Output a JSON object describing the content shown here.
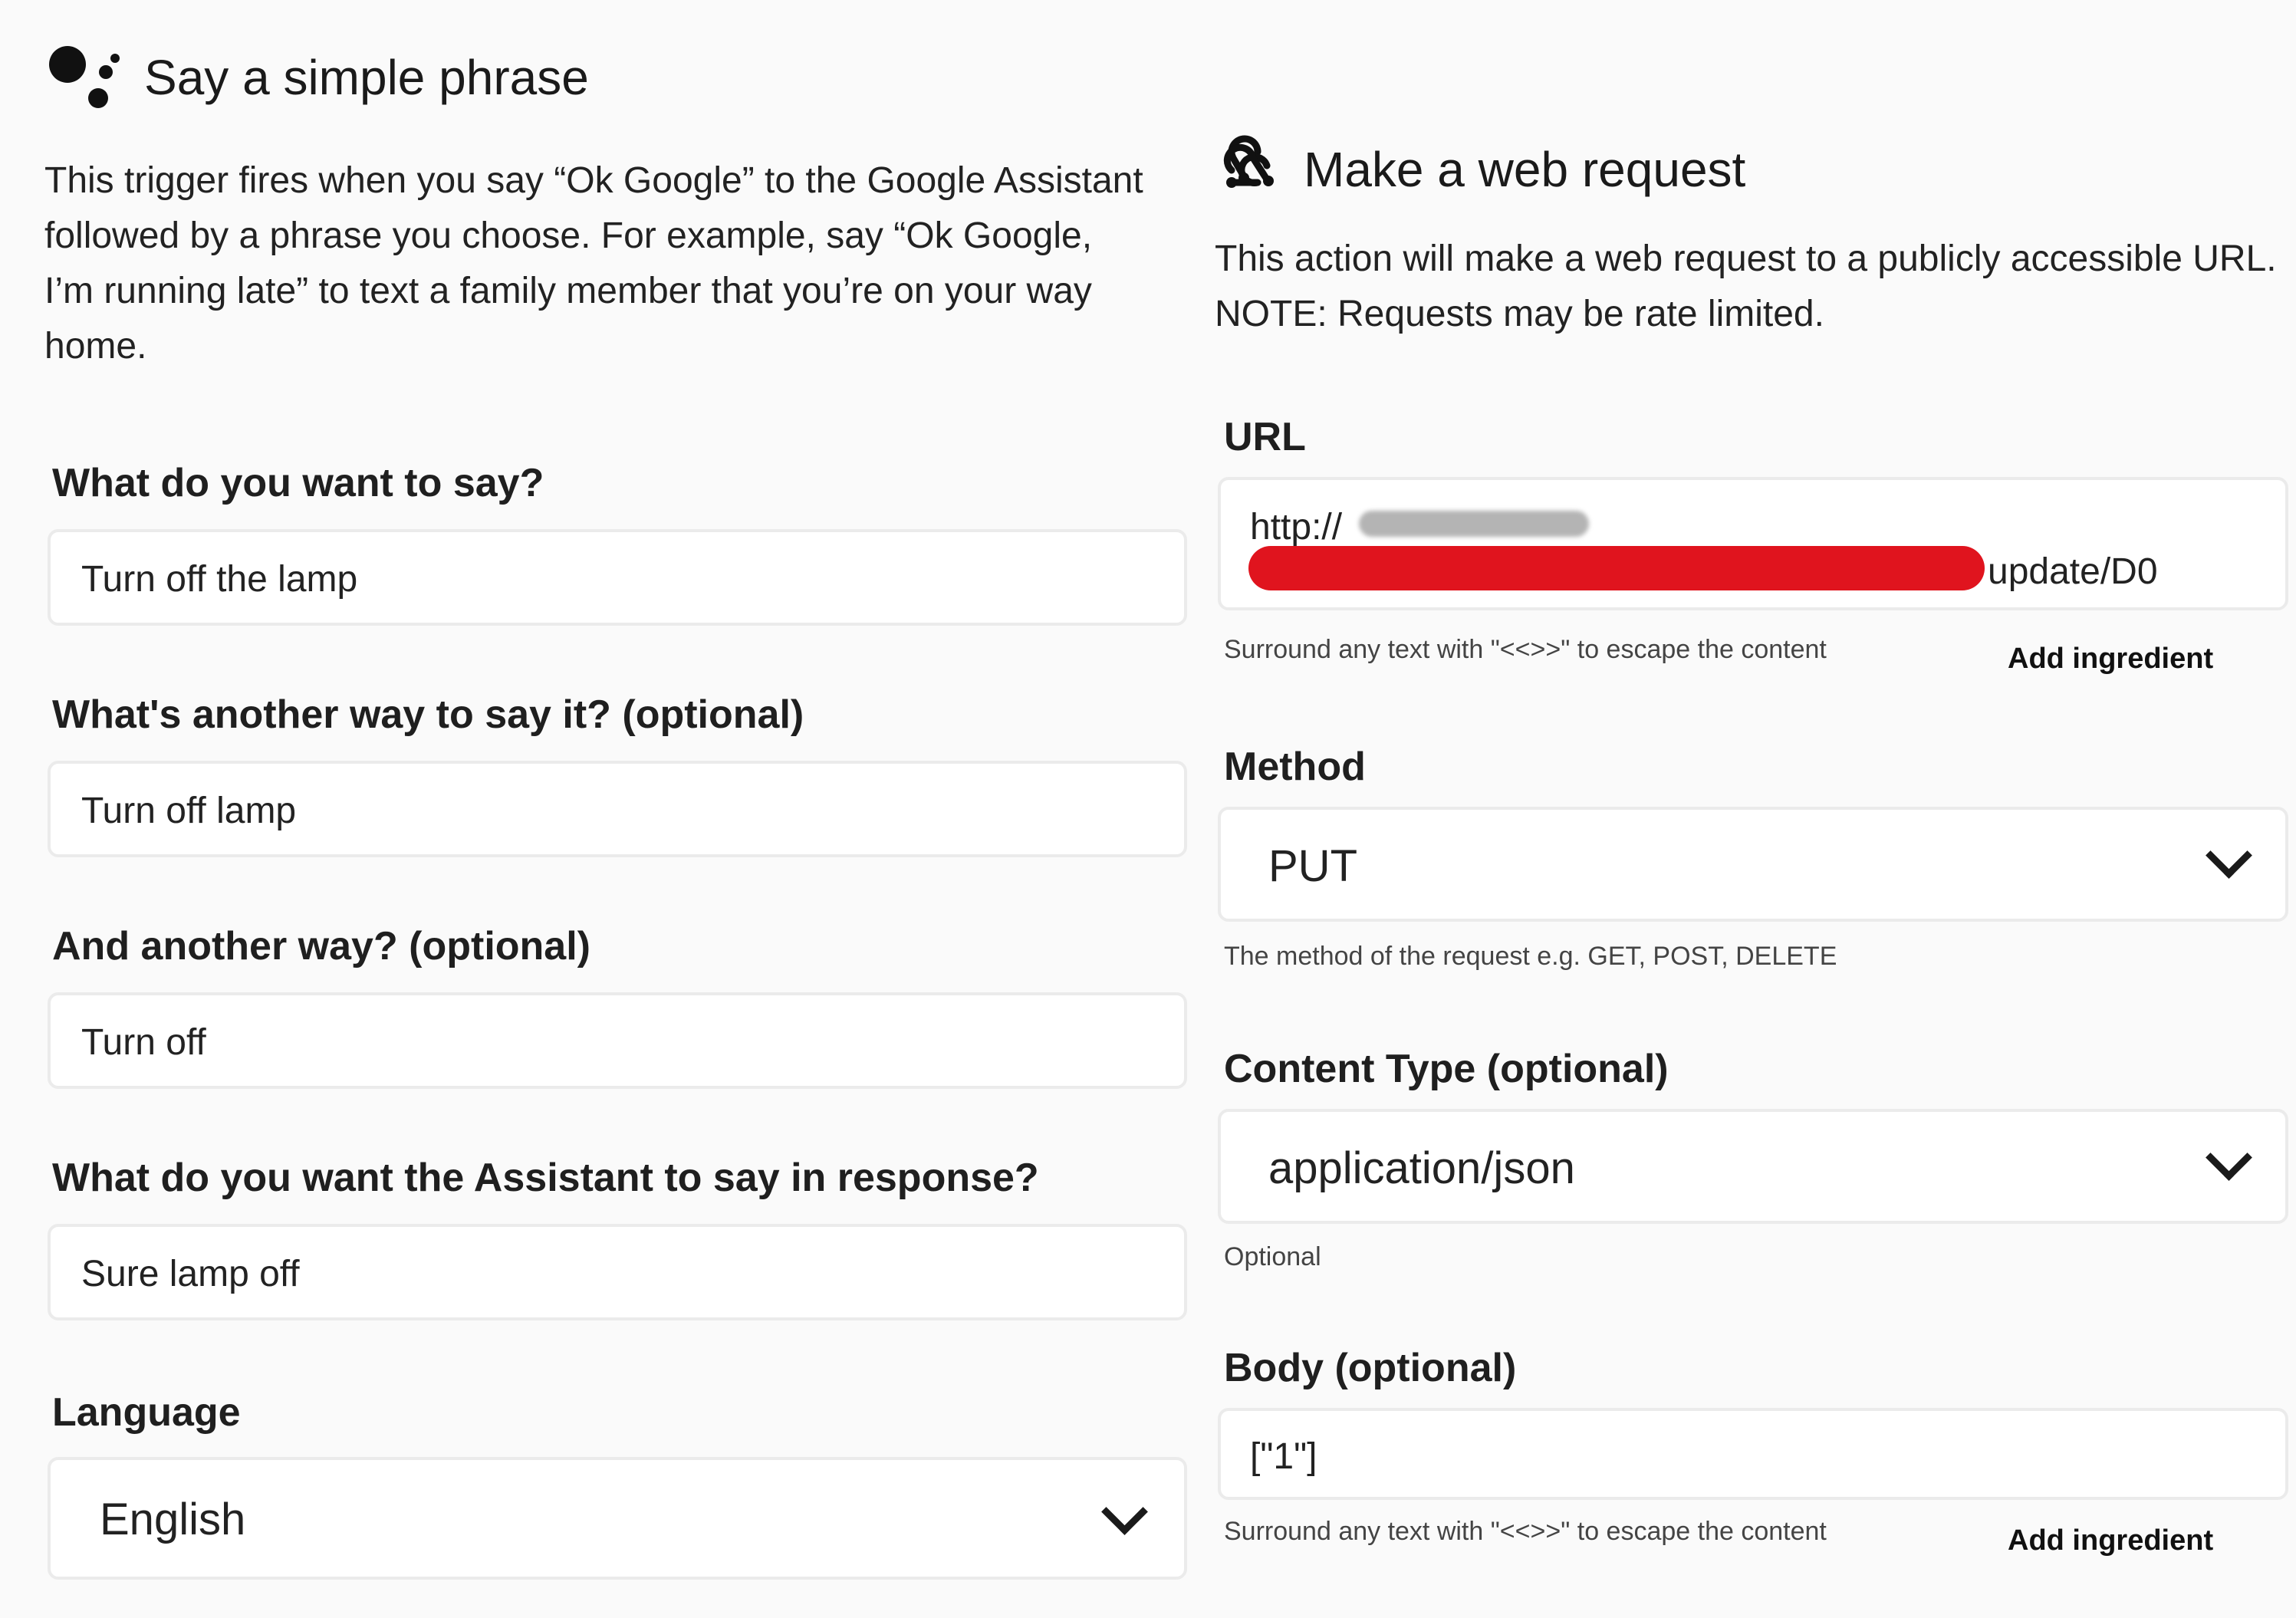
{
  "trigger": {
    "title": "Say a simple phrase",
    "icon": "google-assistant-icon",
    "description": "This trigger fires when you say “Ok Google” to the Google Assistant followed by a phrase you choose. For example, say “Ok Google, I’m running late” to text a family member that you’re on your way home.",
    "fields": {
      "phrase": {
        "label": "What do you want to say?",
        "value": "Turn off the lamp"
      },
      "alt_phrase": {
        "label": "What's another way to say it? (optional)",
        "value": "Turn off lamp"
      },
      "alt_phrase_2": {
        "label": "And another way? (optional)",
        "value": "Turn off"
      },
      "response": {
        "label": "What do you want the Assistant to say in response?",
        "value": "Sure lamp off"
      },
      "language": {
        "label": "Language",
        "value": "English"
      }
    }
  },
  "action": {
    "title": "Make a web request",
    "icon": "webhook-icon",
    "description": "This action will make a web request to a publicly accessible URL. NOTE: Requests may be rate limited.",
    "fields": {
      "url": {
        "label": "URL",
        "value_start": "http://",
        "value_end": "update/D0",
        "helper": "Surround any text with \"<<>>\" to escape the content",
        "add_ingredient": "Add ingredient"
      },
      "method": {
        "label": "Method",
        "value": "PUT",
        "helper": "The method of the request e.g. GET, POST, DELETE"
      },
      "content_type": {
        "label": "Content Type (optional)",
        "value": "application/json",
        "helper": "Optional"
      },
      "body": {
        "label": "Body (optional)",
        "value": "[\"1\"]",
        "helper": "Surround any text with \"<<>>\" to escape the content",
        "add_ingredient": "Add ingredient"
      }
    }
  },
  "colors": {
    "redaction_red": "#e0141e",
    "redaction_gray": "#b4b4b4",
    "input_border": "#ebebeb",
    "panel_bg": "#fafafa"
  }
}
